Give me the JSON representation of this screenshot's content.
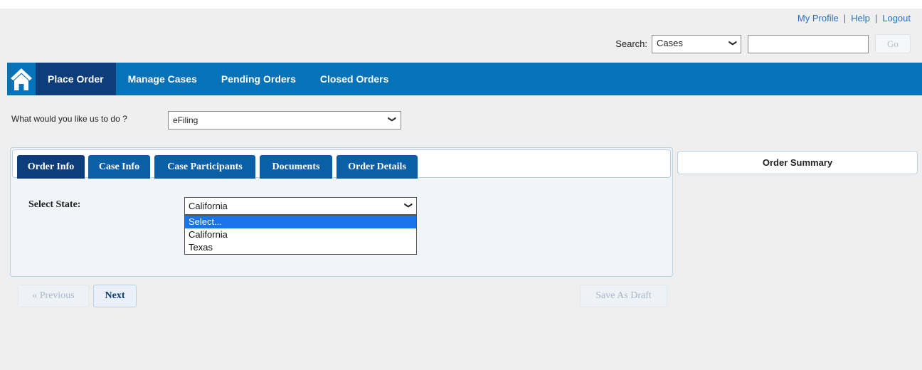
{
  "header": {
    "links": [
      "My Profile",
      "Help",
      "Logout"
    ],
    "separator": "|",
    "search_label": "Search:",
    "search_scope": "Cases",
    "search_value": "",
    "go_label": "Go"
  },
  "nav": {
    "home_icon": "home-icon",
    "items": [
      "Place Order",
      "Manage Cases",
      "Pending Orders",
      "Closed Orders"
    ],
    "active": "Place Order",
    "color": "#0672b7",
    "active_color": "#0d3d7a"
  },
  "task": {
    "label": "What would you like us to do ?",
    "value": "eFiling"
  },
  "tabs": [
    "Order Info",
    "Case Info",
    "Case Participants",
    "Documents",
    "Order Details"
  ],
  "active_tab": "Order Info",
  "state": {
    "label": "Select State:",
    "value": "California",
    "options": [
      "Select...",
      "California",
      "Texas"
    ],
    "highlighted": "Select..."
  },
  "summary": {
    "title": "Order Summary"
  },
  "buttons": {
    "previous": "« Previous",
    "next": "Next",
    "save_draft": "Save As Draft"
  }
}
